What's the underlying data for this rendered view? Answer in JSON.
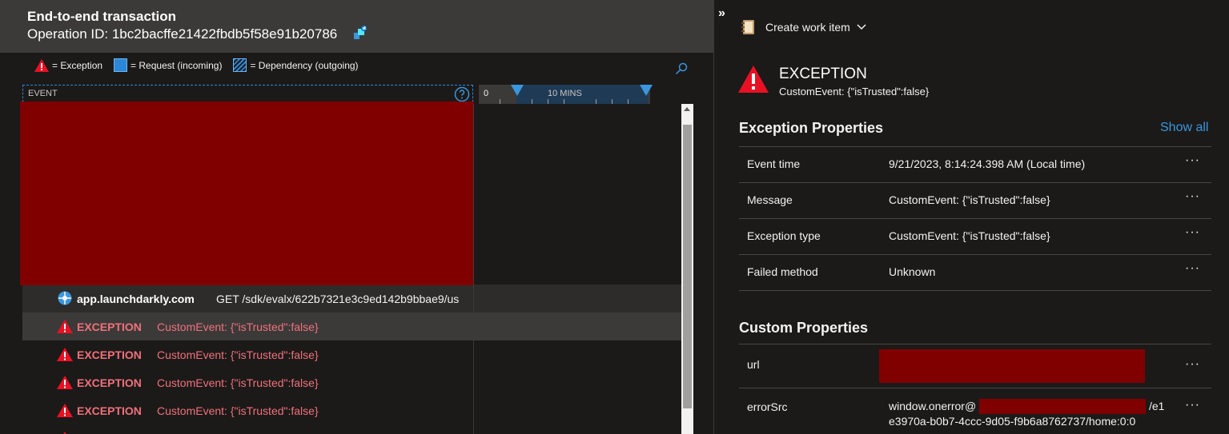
{
  "header": {
    "title": "End-to-end transaction",
    "operation_label": "Operation ID: 1bc2bacffe21422fbdb5f58e91b20786"
  },
  "legend": {
    "exception": "= Exception",
    "request": "= Request (incoming)",
    "dependency": "= Dependency (outgoing)"
  },
  "grid": {
    "event_col": "EVENT",
    "timeline_start": "0",
    "timeline_span": "10 MINS"
  },
  "rows": [
    {
      "type": "dependency",
      "name": "app.launchdarkly.com",
      "detail": "GET /sdk/evalx/622b7321e3c9ed142b9bbae9/us"
    },
    {
      "type": "exception",
      "name": "EXCEPTION",
      "detail": "CustomEvent: {\"isTrusted\":false}"
    },
    {
      "type": "exception",
      "name": "EXCEPTION",
      "detail": "CustomEvent: {\"isTrusted\":false}"
    },
    {
      "type": "exception",
      "name": "EXCEPTION",
      "detail": "CustomEvent: {\"isTrusted\":false}"
    },
    {
      "type": "exception",
      "name": "EXCEPTION",
      "detail": "CustomEvent: {\"isTrusted\":false}"
    }
  ],
  "panel": {
    "create_work_item": "Create work item",
    "exception_title": "EXCEPTION",
    "exception_subtitle": "CustomEvent: {\"isTrusted\":false}",
    "exception_props_title": "Exception Properties",
    "show_all": "Show all",
    "exception_props": [
      {
        "key": "Event time",
        "value": "9/21/2023, 8:14:24.398 AM (Local time)"
      },
      {
        "key": "Message",
        "value": "CustomEvent: {\"isTrusted\":false}"
      },
      {
        "key": "Exception type",
        "value": "CustomEvent: {\"isTrusted\":false}"
      },
      {
        "key": "Failed method",
        "value": "Unknown"
      }
    ],
    "custom_props_title": "Custom Properties",
    "custom_props": [
      {
        "key": "url",
        "value": ""
      },
      {
        "key": "errorSrc",
        "value_line1_start": "window.onerror@",
        "value_line1_end": "/e1",
        "value_line2": "e3970a-b0b7-4ccc-9d05-f9b6a8762737/home:0:0"
      }
    ],
    "more_actions": "···"
  },
  "colors": {
    "exception": "#e81123",
    "exception_text": "#f1707b",
    "accent": "#3a96dd",
    "redaction": "#800000"
  }
}
